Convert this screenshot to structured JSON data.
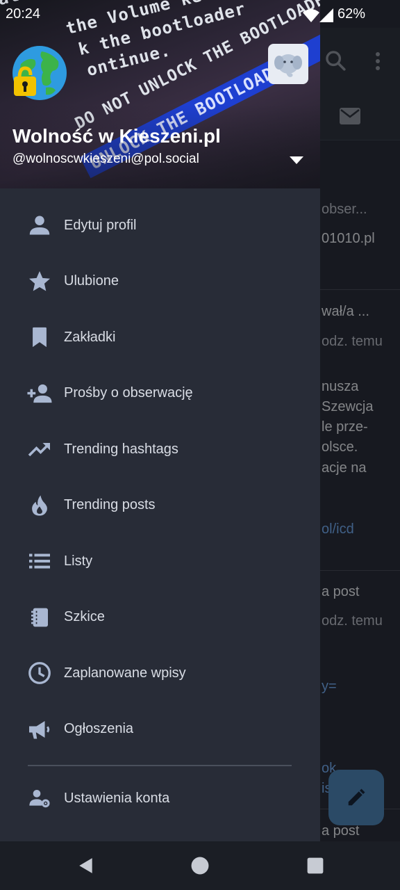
{
  "status_bar": {
    "time": "20:24",
    "battery": "62%",
    "icons": [
      "wifi-icon",
      "signal-icon"
    ]
  },
  "drawer": {
    "header": {
      "account_name": "Wolność w Kieszeni.pl",
      "account_handle": "@wolnoscwkieszeni@pol.social",
      "banner_lines": [
        "also delete",
        "the Volume ke",
        "k the bootloader",
        "ontinue.",
        "DO NOT UNLOCK THE BOOTLOADER",
        "UNLOCK THE BOOTLOADER"
      ]
    },
    "menu": [
      {
        "label": "Edytuj profil",
        "icon": "person-icon"
      },
      {
        "label": "Ulubione",
        "icon": "star-icon"
      },
      {
        "label": "Zakładki",
        "icon": "bookmark-icon"
      },
      {
        "label": "Prośby o obserwację",
        "icon": "person-add-icon"
      },
      {
        "label": "Trending hashtags",
        "icon": "trending-up-icon"
      },
      {
        "label": "Trending posts",
        "icon": "fire-icon"
      },
      {
        "label": "Listy",
        "icon": "list-icon"
      },
      {
        "label": "Szkice",
        "icon": "notebook-icon"
      },
      {
        "label": "Zaplanowane wpisy",
        "icon": "clock-icon"
      },
      {
        "label": "Ogłoszenia",
        "icon": "megaphone-icon"
      }
    ],
    "settings": {
      "label": "Ustawienia konta",
      "icon": "person-settings-icon"
    }
  },
  "background": {
    "snippets": [
      "obser...",
      "01010.pl",
      "wał/a ...",
      "odz. temu",
      "nusza",
      "Szewcja",
      "le prze-",
      "olsce.",
      "acje na",
      "ol/icd",
      "a post",
      "odz. temu",
      "y=",
      "ok",
      "is",
      "a post"
    ]
  },
  "colors": {
    "drawer_bg": "#282c37",
    "accent": "#6fa5e8",
    "fab": "#2b4a66",
    "navbar": "#1b1e25"
  }
}
